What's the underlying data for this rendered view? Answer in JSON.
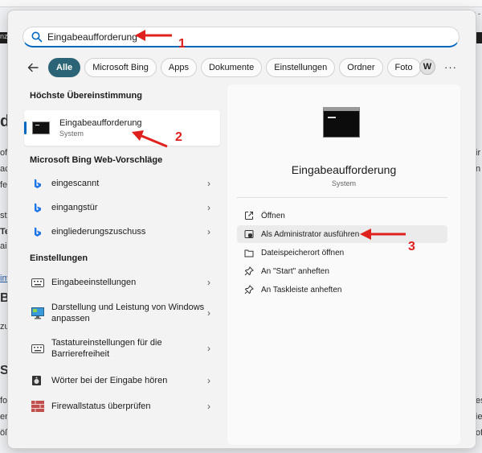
{
  "search": {
    "value": "Eingabeaufforderung"
  },
  "filters": {
    "tabs": [
      {
        "label": "Alle",
        "active": true
      },
      {
        "label": "Microsoft Bing"
      },
      {
        "label": "Apps"
      },
      {
        "label": "Dokumente"
      },
      {
        "label": "Einstellungen"
      },
      {
        "label": "Ordner"
      },
      {
        "label": "Foto"
      }
    ],
    "avatar_initial": "W"
  },
  "best_match": {
    "heading": "Höchste Übereinstimmung",
    "title": "Eingabeaufforderung",
    "subtitle": "System"
  },
  "bing": {
    "heading": "Microsoft Bing Web-Vorschläge",
    "items": [
      {
        "label": "eingescannt"
      },
      {
        "label": "eingangstür"
      },
      {
        "label": "eingliederungszuschuss"
      }
    ]
  },
  "settings": {
    "heading": "Einstellungen",
    "items": [
      {
        "label": "Eingabeeinstellungen",
        "icon": "keyboard-icon"
      },
      {
        "label": "Darstellung und Leistung von Windows anpassen",
        "icon": "monitor-icon"
      },
      {
        "label": "Tastatureinstellungen für die Barrierefreiheit",
        "icon": "keyboard-icon"
      },
      {
        "label": "Wörter bei der Eingabe hören",
        "icon": "speaker-icon"
      },
      {
        "label": "Firewallstatus überprüfen",
        "icon": "firewall-icon"
      }
    ]
  },
  "detail": {
    "title": "Eingabeaufforderung",
    "subtitle": "System",
    "actions": [
      {
        "label": "Öffnen",
        "icon": "open-icon"
      },
      {
        "label": "Als Administrator ausführen",
        "icon": "admin-shield-icon"
      },
      {
        "label": "Dateispeicherort öffnen",
        "icon": "folder-icon"
      },
      {
        "label": "An \"Start\" anheften",
        "icon": "pin-icon"
      },
      {
        "label": "An Taskleiste anheften",
        "icon": "pin-icon"
      }
    ]
  },
  "annotations": [
    "1",
    "2",
    "3"
  ],
  "background_fragments": [
    "nz",
    "d",
    "of",
    "ac",
    "fe",
    "st",
    "Te",
    "ail",
    "im",
    "B",
    "zu",
    "SU",
    "fo",
    "en",
    "öß",
    "s -",
    "ir",
    "n",
    "es",
    "ie",
    "of",
    "n"
  ],
  "colors": {
    "accent": "#0067c0",
    "active_chip": "#2a6476",
    "annotation": "#e0201c"
  }
}
